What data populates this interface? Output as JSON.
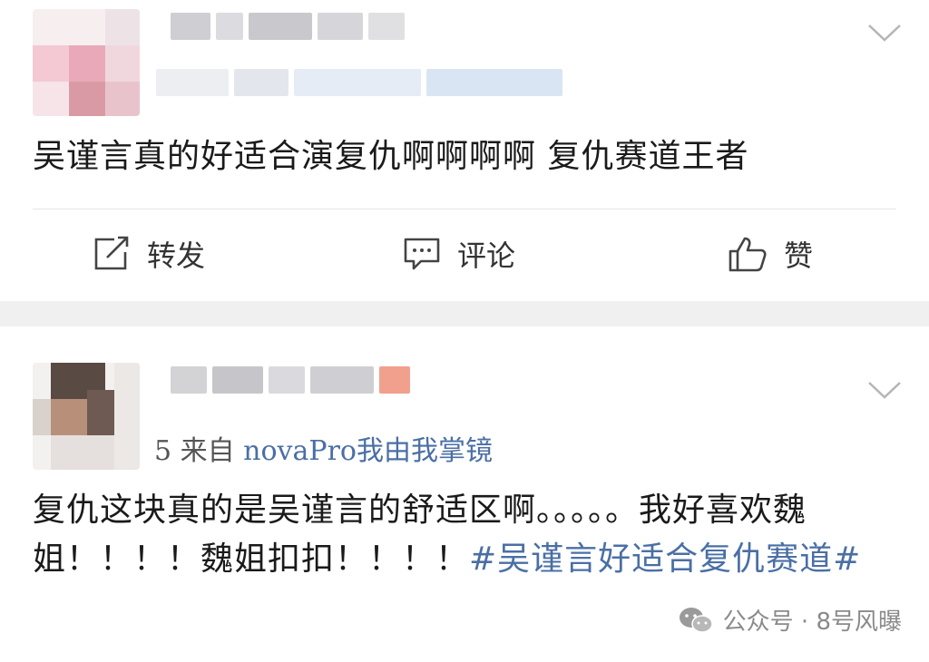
{
  "post1": {
    "content": "吴谨言真的好适合演复仇啊啊啊啊 复仇赛道王者",
    "actions": {
      "repost_label": "转发",
      "comment_label": "评论",
      "like_label": "赞"
    }
  },
  "post2": {
    "source_prefix": "5  来自 ",
    "source_device": "novaPro我由我掌镜",
    "content_text": "复仇这块真的是吴谨言的舒适区啊。。。。。我好喜欢魏姐！！！！魏姐扣扣！！！！",
    "content_hashtag": "#吴谨言好适合复仇赛道#"
  },
  "watermark": {
    "text": "公众号 · 8号风曝",
    "icon": "wechat-icon"
  },
  "icons": {
    "repost": "repost-icon",
    "comment": "comment-icon",
    "like": "thumbs-up-icon",
    "menu": "chevron-down-icon"
  },
  "colors": {
    "hashtag": "#4a6fa5",
    "separator": "#f0f0f0",
    "text": "#1a1a1a"
  }
}
